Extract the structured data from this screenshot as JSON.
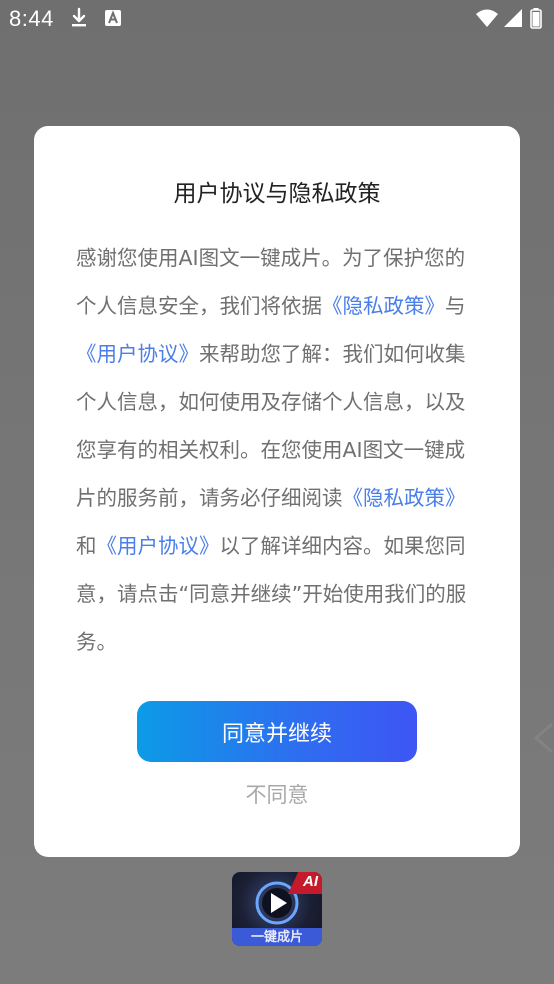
{
  "status_bar": {
    "time": "8:44",
    "icons": [
      "download-icon",
      "a-notification-icon",
      "wifi-icon",
      "signal-icon",
      "battery-icon"
    ]
  },
  "background_app": {
    "icon_badge": "AI",
    "icon_label": "一键成片"
  },
  "dialog": {
    "title": "用户协议与隐私政策",
    "body": [
      {
        "text": "感谢您使用AI图文一键成片。为了保护您的个人信息安全，我们将依据",
        "link": false
      },
      {
        "text": "《隐私政策》",
        "link": true
      },
      {
        "text": "与",
        "link": false
      },
      {
        "text": "《用户协议》",
        "link": true
      },
      {
        "text": "来帮助您了解：我们如何收集个人信息，如何使用及存储个人信息，以及您享有的相关权利。在您使用AI图文一键成片的服务前，请务必仔细阅读",
        "link": false
      },
      {
        "text": "《隐私政策》",
        "link": true
      },
      {
        "text": "和",
        "link": false
      },
      {
        "text": "《用户协议》",
        "link": true
      },
      {
        "text": "以了解详细内容。如果您同意，请点击“同意并继续”开始使用我们的服务。",
        "link": false
      }
    ],
    "agree_label": "同意并继续",
    "disagree_label": "不同意"
  },
  "colors": {
    "link": "#4a7ee8",
    "button_gradient_start": "#0c9be6",
    "button_gradient_end": "#3e55f4",
    "overlay": "#767676"
  }
}
